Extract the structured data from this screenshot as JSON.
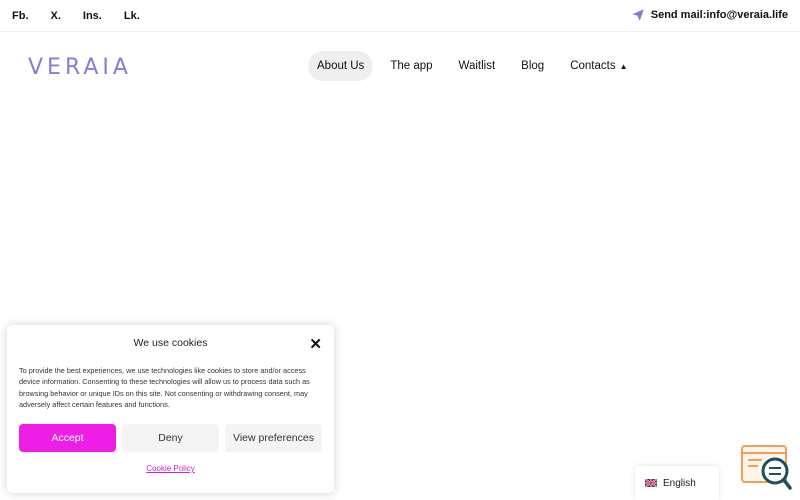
{
  "topbar": {
    "social": [
      "Fb.",
      "X.",
      "Ins.",
      "Lk."
    ],
    "mail_label": "Send mail:info@veraia.life"
  },
  "header": {
    "logo": "VERAIA",
    "nav": [
      {
        "label": "About Us",
        "active": true
      },
      {
        "label": "The app"
      },
      {
        "label": "Waitlist"
      },
      {
        "label": "Blog"
      },
      {
        "label": "Contacts",
        "dropdown": true
      }
    ]
  },
  "cookie": {
    "title": "We use cookies",
    "text": "To provide the best experiences, we use technologies like cookies to store and/or access device information. Consenting to these technologies will allow us to process data such as browsing behavior or unique IDs on this site. Not consenting or withdrawing consent, may adversely affect certain features and functions.",
    "accept": "Accept",
    "deny": "Deny",
    "preferences": "View preferences",
    "policy": "Cookie Policy",
    "accent": "#ee1ee6"
  },
  "language": {
    "label": "English"
  },
  "colors": {
    "logo": "#8e7ad6",
    "accent": "#ee1ee6"
  }
}
